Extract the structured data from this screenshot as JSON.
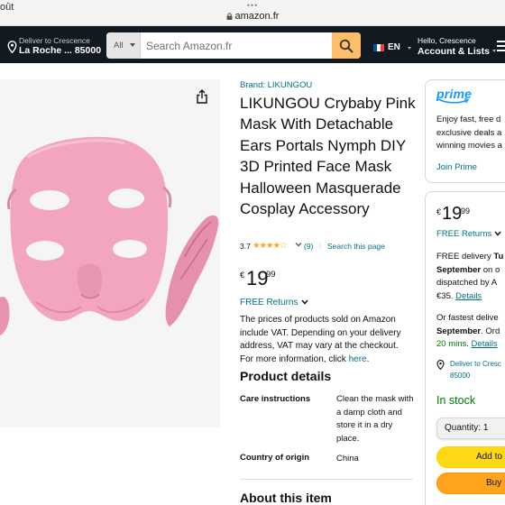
{
  "browser": {
    "edge_text": "oût",
    "url": "amazon.fr"
  },
  "nav": {
    "deliver_line1": "Deliver to Crescence",
    "deliver_line2": "La Roche ... 85000",
    "search_category": "All",
    "search_placeholder": "Search Amazon.fr",
    "lang_code": "EN",
    "account_line1": "Hello, Crescence",
    "account_line2": "Account & Lists",
    "colors": {
      "bar": "#131921",
      "search_button": "#febd69"
    },
    "icons": [
      "location-pin-icon",
      "search-icon",
      "france-flag-icon",
      "chevron-down-icon",
      "menu-icon"
    ]
  },
  "gallery": {
    "share_icon": "share-icon",
    "image_alt": "Pink crybaby mask with detachable ears"
  },
  "product": {
    "brand": "Brand: LIKUNGOU",
    "title": "LIKUNGOU Crybaby Pink Mask With Detachable Ears Portals Nymph DIY 3D Printed Face Mask Halloween Masquerade Cosplay Accessory",
    "rating_value": "3.7",
    "stars": "★★★★☆",
    "rating_fraction": 0.74,
    "rating_count": "(9)",
    "rating_sep": "|",
    "search_this_page": "Search this page",
    "price_symbol": "€",
    "price_whole": "19",
    "price_fraction": "99",
    "free_returns": "FREE Returns",
    "vat_text": "The prices of products sold on Amazon include VAT. Depending on your delivery address, VAT may vary at the checkout. For more information, click ",
    "vat_link": "here",
    "vat_end": "."
  },
  "details": {
    "heading": "Product details",
    "rows": [
      {
        "label": "Care instructions",
        "value": "Clean the mask with a damp cloth and store it in a dry place."
      },
      {
        "label": "Country of origin",
        "value": "China"
      }
    ],
    "about_heading": "About this item"
  },
  "prime": {
    "logo_text": "prime",
    "line1": "Enjoy fast, free d",
    "line2": "exclusive deals a",
    "line3": "winning movies a",
    "join": "Join Prime",
    "color": "#1399ff"
  },
  "buybox": {
    "price_symbol": "€",
    "price_whole": "19",
    "price_fraction": "99",
    "free_returns": "FREE Returns",
    "delivery_1a": "FREE delivery ",
    "delivery_1b": "Tu",
    "delivery_2a": "September",
    "delivery_2b": " on o",
    "delivery_3": "dispatched by A",
    "delivery_4a": "€35. ",
    "delivery_4b": "Details",
    "fastest_1": "Or fastest delive",
    "fastest_2a": "September",
    "fastest_2b": ". Ord",
    "fastest_3a": "20 mins",
    "fastest_3b": ". ",
    "fastest_3c": "Details",
    "deliver_to_1": "Deliver to Cresc",
    "deliver_to_2": "85000",
    "stock": "In stock",
    "quantity_label": "Quantity:",
    "quantity_value": "1",
    "add_to_cart": "Add to",
    "buy_now": "Buy I",
    "colors": {
      "in_stock": "#007600",
      "add_button": "#ffd814",
      "buy_button": "#ffa41c"
    }
  }
}
